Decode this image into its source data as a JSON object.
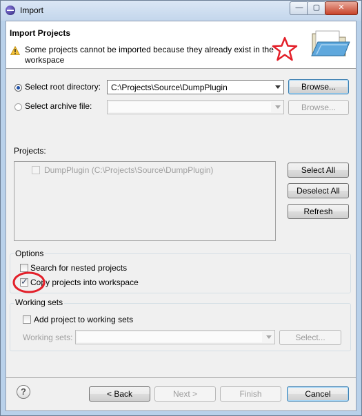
{
  "window": {
    "title": "Import"
  },
  "header": {
    "title": "Import Projects",
    "message": "Some projects cannot be imported because they already exist in the workspace"
  },
  "source": {
    "root_radio_label": "Select root directory:",
    "root_path": "C:\\Projects\\Source\\DumpPlugin",
    "archive_radio_label": "Select archive file:",
    "archive_path": "",
    "browse_label": "Browse...",
    "browse_archive_label": "Browse..."
  },
  "projects": {
    "label": "Projects:",
    "items": [
      "DumpPlugin (C:\\Projects\\Source\\DumpPlugin)"
    ],
    "select_all": "Select All",
    "deselect_all": "Deselect All",
    "refresh": "Refresh"
  },
  "options": {
    "title": "Options",
    "nested_label": "Search for nested projects",
    "copy_label": "Copy projects into workspace",
    "nested_checked": false,
    "copy_checked": true
  },
  "working_sets": {
    "title": "Working sets",
    "add_label": "Add project to working sets",
    "sets_label": "Working sets:",
    "sets_value": "",
    "select_label": "Select..."
  },
  "footer": {
    "help": "?",
    "back": "< Back",
    "next": "Next >",
    "finish": "Finish",
    "cancel": "Cancel"
  },
  "icons": {
    "title": "eclipse-icon",
    "warning": "warning-icon",
    "banner": "folder-icon",
    "help": "help-icon"
  },
  "annotation_colors": {
    "red": "#e3202a"
  }
}
